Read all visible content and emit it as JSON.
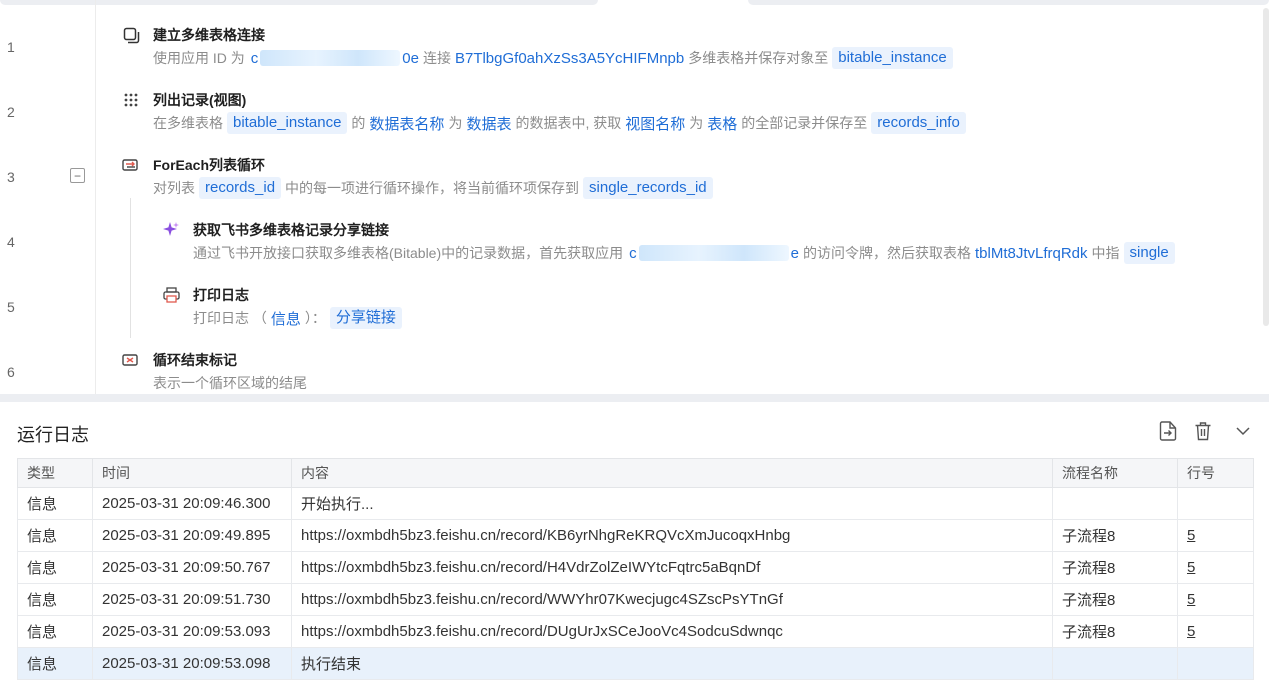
{
  "line_numbers": [
    "1",
    "2",
    "3",
    "4",
    "5",
    "6"
  ],
  "steps": {
    "s1": {
      "title": "建立多维表格连接",
      "icon": "window-copy-icon",
      "desc_prefix": "使用应用 ID 为",
      "masked_start": "c",
      "masked_end": "0e",
      "connect_word": "连接",
      "app_token": "B7TlbgGf0ahXzSs3A5YcHIFMnpb",
      "save_text": "多维表格并保存对象至",
      "var": "bitable_instance"
    },
    "s2": {
      "title": "列出记录(视图)",
      "icon": "grid-dots-icon",
      "p1": "在多维表格",
      "var_in": "bitable_instance",
      "p2": "的",
      "table_name_label": "数据表名称",
      "p3": "为",
      "table_name": "数据表",
      "p4": "的数据表中, 获取",
      "view_name_label": "视图名称",
      "p5": "为",
      "view_name": "表格",
      "p6": "的全部记录并保存至",
      "var_out": "records_info"
    },
    "s3": {
      "title": "ForEach列表循环",
      "icon": "loop-icon",
      "p1": "对列表",
      "list_var": "records_id",
      "p2": "中的每一项进行循环操作，将当前循环项保存到",
      "item_var": "single_records_id"
    },
    "s4": {
      "title": "获取飞书多维表格记录分享链接",
      "icon": "sparkle-icon",
      "p1": "通过飞书开放接口获取多维表格(Bitable)中的记录数据，首先获取应用",
      "masked_start": "c",
      "masked_end": "e",
      "p2": "的访问令牌，然后获取表格",
      "table_id": "tblMt8JtvLfrqRdk",
      "p3": "中指",
      "trail_chip": "single"
    },
    "s5": {
      "title": "打印日志",
      "icon": "printer-icon",
      "p1": "打印日志 （",
      "level": "信息",
      "p2": "）：",
      "content": "分享链接"
    },
    "s6": {
      "title": "循环结束标记",
      "icon": "loop-end-icon",
      "desc": "表示一个循环区域的结尾"
    }
  },
  "log": {
    "title": "运行日志",
    "tools": [
      "export-icon",
      "trash-icon",
      "chevron-down-icon"
    ],
    "columns": [
      "类型",
      "时间",
      "内容",
      "流程名称",
      "行号"
    ],
    "rows": [
      {
        "type": "信息",
        "time": "2025-03-31 20:09:46.300",
        "content": "开始执行...",
        "flow": "",
        "line": ""
      },
      {
        "type": "信息",
        "time": "2025-03-31 20:09:49.895",
        "content": "https://oxmbdh5bz3.feishu.cn/record/KB6yrNhgReKRQVcXmJucoqxHnbg",
        "flow": "子流程8",
        "line": "5"
      },
      {
        "type": "信息",
        "time": "2025-03-31 20:09:50.767",
        "content": "https://oxmbdh5bz3.feishu.cn/record/H4VdrZolZeIWYtcFqtrc5aBqnDf",
        "flow": "子流程8",
        "line": "5"
      },
      {
        "type": "信息",
        "time": "2025-03-31 20:09:51.730",
        "content": "https://oxmbdh5bz3.feishu.cn/record/WWYhr07Kwecjugc4SZscPsYTnGf",
        "flow": "子流程8",
        "line": "5"
      },
      {
        "type": "信息",
        "time": "2025-03-31 20:09:53.093",
        "content": "https://oxmbdh5bz3.feishu.cn/record/DUgUrJxSCeJooVc4SodcuSdwnqc",
        "flow": "子流程8",
        "line": "5"
      },
      {
        "type": "信息",
        "time": "2025-03-31 20:09:53.098",
        "content": "执行结束",
        "flow": "",
        "line": ""
      }
    ]
  },
  "colors": {
    "accent": "#1f6dd6",
    "chip_bg": "#eaf2fd",
    "selected_row": "#e8f1fb"
  }
}
